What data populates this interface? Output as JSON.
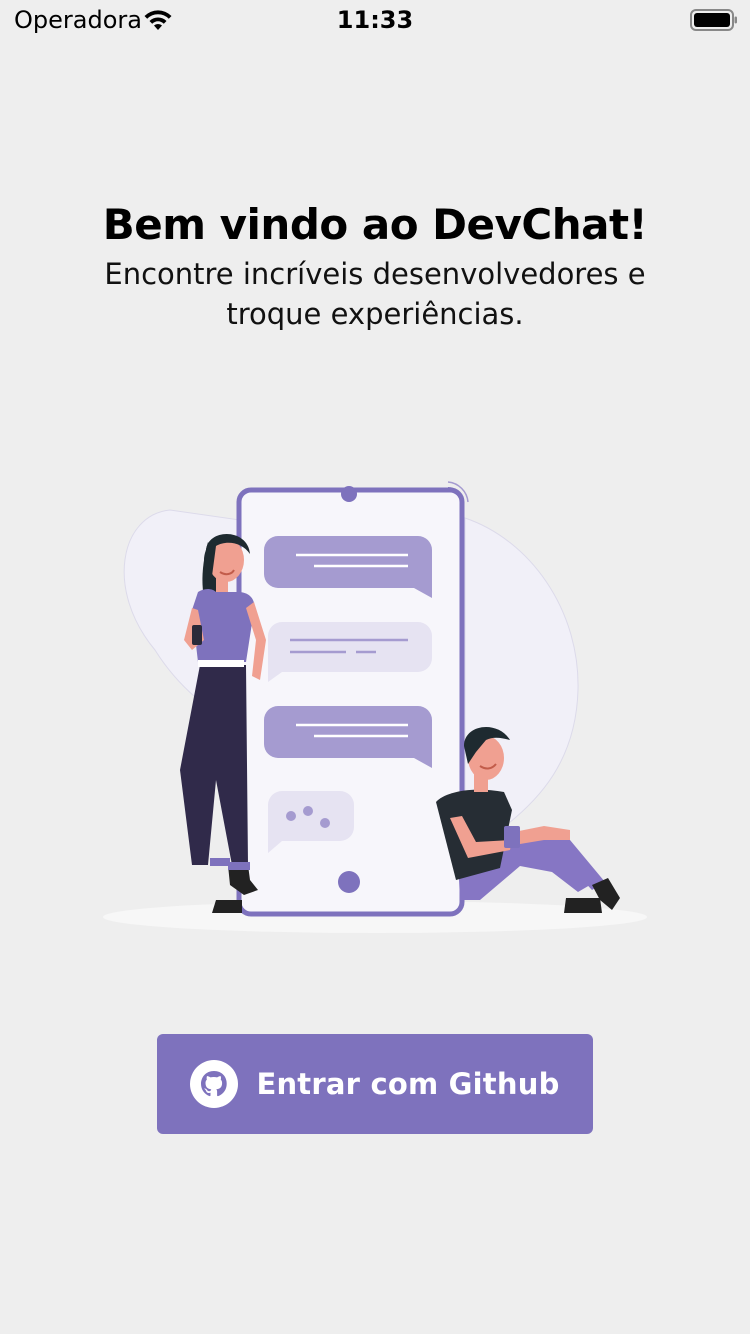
{
  "status_bar": {
    "carrier": "Operadora",
    "time": "11:33",
    "wifi_icon": "wifi-icon",
    "battery_icon": "battery-icon"
  },
  "welcome": {
    "title": "Bem vindo ao DevChat!",
    "subtitle": "Encontre incríveis desenvolvedores e troque experiências."
  },
  "illustration": {
    "description_icon": "people-chatting-phone-illustration"
  },
  "login": {
    "button_label": "Entrar com Github",
    "icon": "github-icon"
  },
  "colors": {
    "background": "#eeeeee",
    "accent": "#7e72bd",
    "accent_light": "#a59bd0",
    "bubble_light": "#e6e3f2",
    "text": "#000000",
    "button_text": "#ffffff"
  }
}
